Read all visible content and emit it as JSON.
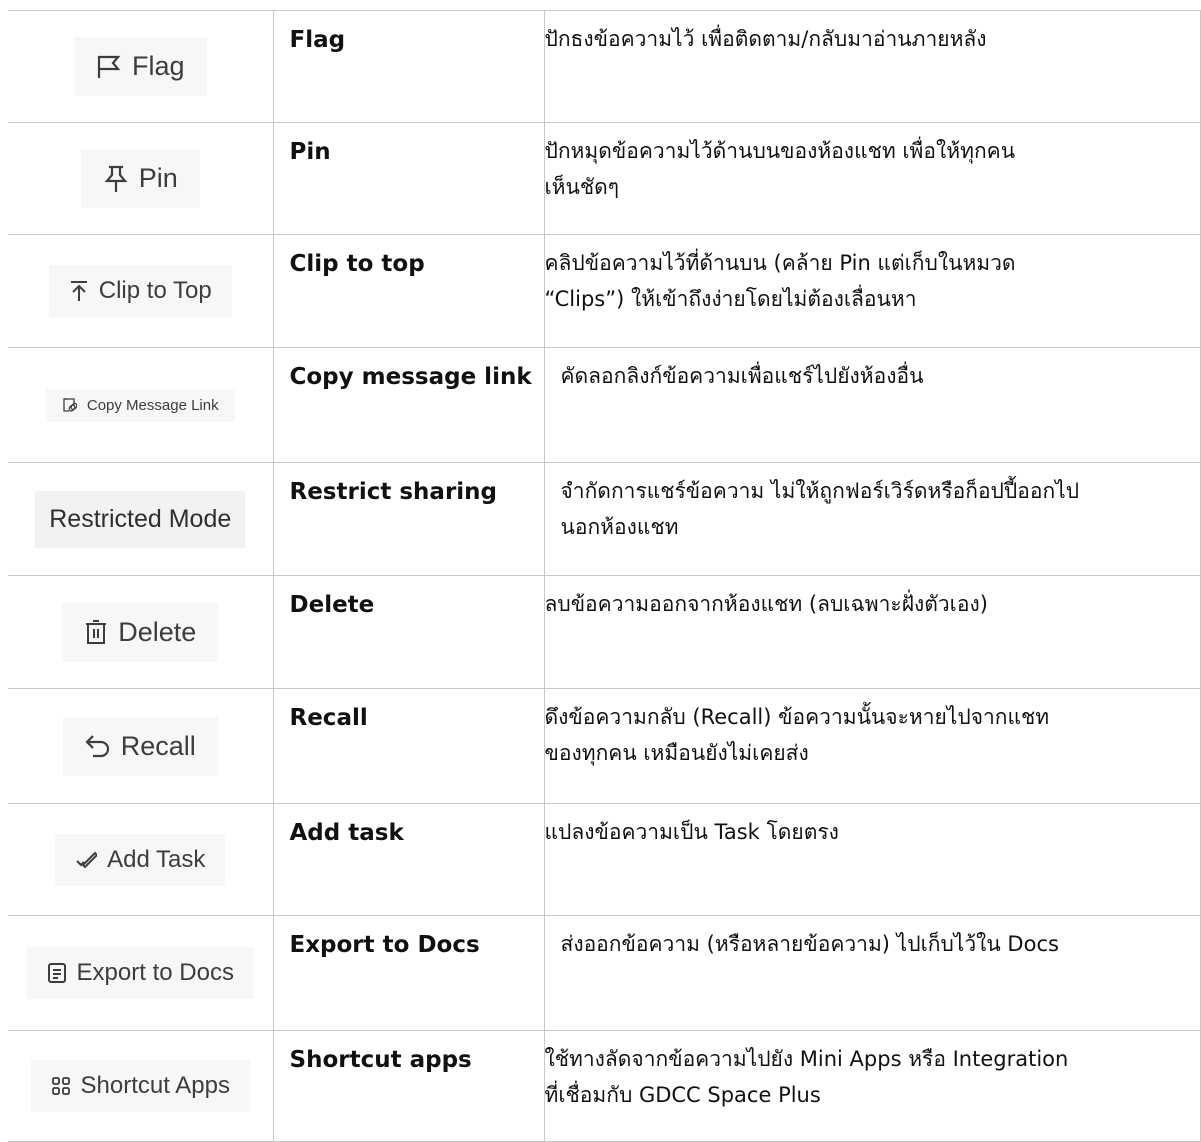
{
  "rows": [
    {
      "button": {
        "label": "Flag",
        "icon": "flag-icon"
      },
      "name": "Flag",
      "description": [
        "ปักธงข้อความไว้ เพื่อติดตาม/กลับมาอ่านภายหลัง"
      ]
    },
    {
      "button": {
        "label": "Pin",
        "icon": "pin-icon"
      },
      "name": "Pin",
      "description": [
        "ปักหมุดข้อความไว้ด้านบนของห้องแชท เพื่อให้ทุกคน",
        "เห็นชัดๆ"
      ]
    },
    {
      "button": {
        "label": "Clip to Top",
        "icon": "arrow-to-top-icon"
      },
      "name": "Clip to top",
      "description": [
        "คลิปข้อความไว้ที่ด้านบน (คล้าย Pin แต่เก็บในหมวด",
        "“Clips”) ให้เข้าถึงง่ายโดยไม่ต้องเลื่อนหา"
      ]
    },
    {
      "button": {
        "label": "Copy Message Link",
        "icon": "link-icon"
      },
      "name": "Copy message link",
      "description": [
        "คัดลอกลิงก์ข้อความเพื่อแชร์ไปยังห้องอื่น"
      ]
    },
    {
      "button": {
        "label": "Restricted Mode",
        "icon": ""
      },
      "name": "Restrict sharing",
      "description": [
        "จำกัดการแชร์ข้อความ ไม่ให้ถูกฟอร์เวิร์ดหรือก็อปปี้ออกไป",
        "นอกห้องแชท"
      ]
    },
    {
      "button": {
        "label": "Delete",
        "icon": "trash-icon"
      },
      "name": "Delete",
      "description": [
        "ลบข้อความออกจากห้องแชท (ลบเฉพาะฝั่งตัวเอง)"
      ]
    },
    {
      "button": {
        "label": "Recall",
        "icon": "undo-icon"
      },
      "name": "Recall",
      "description": [
        "ดึงข้อความกลับ (Recall) ข้อความนั้นจะหายไปจากแชท",
        "ของทุกคน เหมือนยังไม่เคยส่ง"
      ]
    },
    {
      "button": {
        "label": "Add Task",
        "icon": "task-check-icon"
      },
      "name": "Add task",
      "description": [
        "แปลงข้อความเป็น Task โดยตรง"
      ]
    },
    {
      "button": {
        "label": "Export to Docs",
        "icon": "document-icon"
      },
      "name": "Export to Docs",
      "description": [
        "ส่งออกข้อความ (หรือหลายข้อความ) ไปเก็บไว้ใน Docs"
      ]
    },
    {
      "button": {
        "label": "Shortcut Apps",
        "icon": "apps-grid-icon"
      },
      "name": "Shortcut apps",
      "description": [
        "ใช้ทางลัดจากข้อความไปยัง Mini Apps หรือ Integration",
        "ที่เชื่อมกับ GDCC Space Plus"
      ]
    }
  ]
}
